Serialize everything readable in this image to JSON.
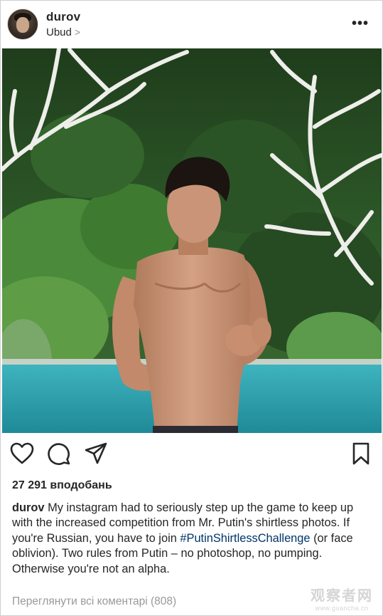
{
  "post": {
    "username": "durov",
    "location": "Ubud",
    "location_chevron": ">",
    "more_label": "•••",
    "likes": "27 291 вподобань",
    "caption_user": "durov",
    "caption_text_1": " My instagram had to seriously step up the game to keep up with the increased competition from Mr. Putin's shirtless photos. If you're Russian, you have to join ",
    "hashtag": "#PutinShirtlessChallenge",
    "caption_text_2": " (or face oblivion). Two rules from Putin – no photoshop, no pumping. Otherwise you're not an alpha.",
    "view_comments": "Переглянути всі коментарі (808)"
  },
  "icons": {
    "like": "heart-icon",
    "comment": "comment-icon",
    "share": "share-icon",
    "save": "bookmark-icon",
    "more": "more-dots-icon"
  },
  "watermark": {
    "line1": "观察者网",
    "line2": "www.guancha.cn"
  },
  "colors": {
    "text": "#262626",
    "muted": "#999999",
    "hashtag": "#003569",
    "pool": "#2fa3b0",
    "foliage": "#2f5a2a"
  }
}
